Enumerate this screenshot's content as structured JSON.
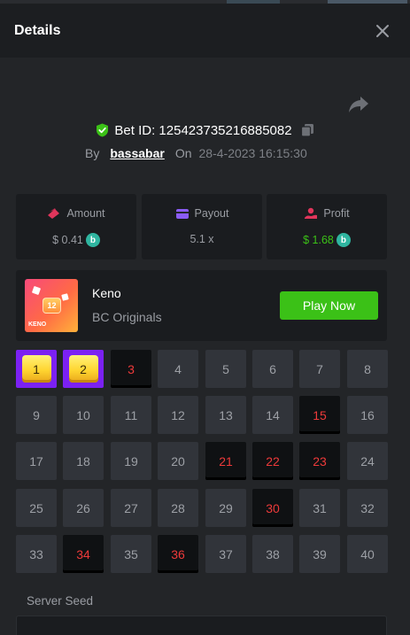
{
  "header": {
    "title": "Details"
  },
  "bet": {
    "id_label": "Bet ID: 125423735216885082"
  },
  "meta": {
    "by": "By",
    "user": "bassabar",
    "on": "On",
    "date": "28-4-2023 16:15:30"
  },
  "stats": {
    "amount": {
      "label": "Amount",
      "value": "$ 0.41"
    },
    "payout": {
      "label": "Payout",
      "value": "5.1 x"
    },
    "profit": {
      "label": "Profit",
      "value": "$ 1.68"
    }
  },
  "game": {
    "name": "Keno",
    "provider": "BC Originals",
    "thumb_badge": "12",
    "thumb_tag": "KENO",
    "play_label": "Play Now"
  },
  "keno": {
    "numbers": [
      "1",
      "2",
      "3",
      "4",
      "5",
      "6",
      "7",
      "8",
      "9",
      "10",
      "11",
      "12",
      "13",
      "14",
      "15",
      "16",
      "17",
      "18",
      "19",
      "20",
      "21",
      "22",
      "23",
      "24",
      "25",
      "26",
      "27",
      "28",
      "29",
      "30",
      "31",
      "32",
      "33",
      "34",
      "35",
      "36",
      "37",
      "38",
      "39",
      "40"
    ],
    "hits": [
      1,
      2
    ],
    "drawn": [
      3,
      15,
      21,
      22,
      23,
      30,
      34,
      36
    ]
  },
  "seed": {
    "label": "Server Seed"
  },
  "colors": {
    "accent_green": "#3bc117",
    "hit_purple": "#7b21f3",
    "drawn_red": "#ed3a3a",
    "coin_teal": "#2fb5a0"
  },
  "icons": {
    "close": "close-icon",
    "share": "share-icon",
    "shield": "shield-check-icon",
    "copy": "copy-icon",
    "amount": "amount-icon",
    "payout": "wallet-icon",
    "profit": "profit-icon",
    "coin": "bc-coin-icon"
  }
}
